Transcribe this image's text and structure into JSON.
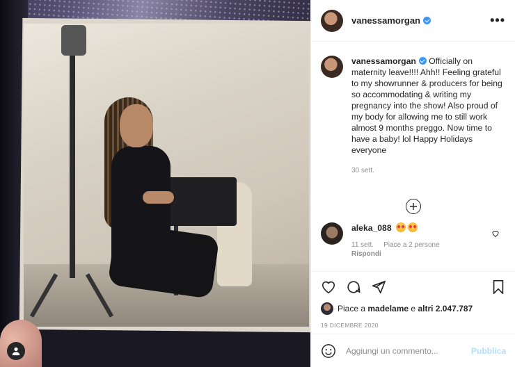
{
  "post": {
    "username": "vanessamorgan",
    "more_label": "•••"
  },
  "caption": {
    "username": "vanessamorgan",
    "text": "Officially on maternity leave!!!! Ahh!! Feeling grateful to my showrunner & producers for being so accommodating & writing my pregnancy into the show! Also proud of my body for allowing me to still work almost 9 months preggo. Now time to have a baby! lol Happy Holidays everyone",
    "date": "30 sett."
  },
  "comment": {
    "username": "aleka_088",
    "time": "11 sett.",
    "likes": "Piace a 2 persone",
    "reply": "Rispondi"
  },
  "likes": {
    "prefix": "Piace a",
    "user": "madelame",
    "middle": "e",
    "others": "altri 2.047.787"
  },
  "post_date": "19 DICEMBRE 2020",
  "add_comment": {
    "placeholder": "Aggiungi un commento...",
    "publish": "Pubblica"
  },
  "colors": {
    "verified": "#3897f0",
    "publish": "#b2dffc",
    "meta": "#8e8e8e"
  },
  "icons": [
    "verified-badge-icon",
    "more-options-icon",
    "load-more-comments-icon",
    "heart-icon",
    "comment-icon",
    "share-icon",
    "bookmark-icon",
    "emoji-icon",
    "user-icon"
  ]
}
